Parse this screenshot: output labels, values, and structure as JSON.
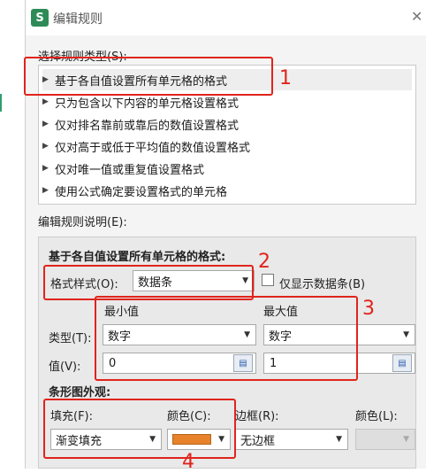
{
  "dialog": {
    "title": "编辑规则",
    "app_icon_letter": "S"
  },
  "rule_type": {
    "label": "选择规则类型(S):",
    "items": [
      "基于各自值设置所有单元格的格式",
      "只为包含以下内容的单元格设置格式",
      "仅对排名靠前或靠后的数值设置格式",
      "仅对高于或低于平均值的数值设置格式",
      "仅对唯一值或重复值设置格式",
      "使用公式确定要设置格式的单元格"
    ]
  },
  "description": {
    "label": "编辑规则说明(E):",
    "heading": "基于各自值设置所有单元格的格式:",
    "format_style_label": "格式样式(O):",
    "format_style_value": "数据条",
    "only_bar_label": "仅显示数据条(B)",
    "min_label": "最小值",
    "max_label": "最大值",
    "type_label": "类型(T):",
    "min_type": "数字",
    "max_type": "数字",
    "value_label": "值(V):",
    "min_value": "0",
    "max_value": "1",
    "bar_appearance": "条形图外观:",
    "fill_label": "填充(F):",
    "fill_value": "渐变填充",
    "color_label": "颜色(C):",
    "border_label": "边框(R):",
    "border_value": "无边框",
    "border_color_label": "颜色(L):"
  },
  "annotations": [
    "1",
    "2",
    "3",
    "4"
  ],
  "colors": {
    "bar_color": "#e8822b",
    "annotation": "#e0241c",
    "icon": "#2e8b57"
  }
}
